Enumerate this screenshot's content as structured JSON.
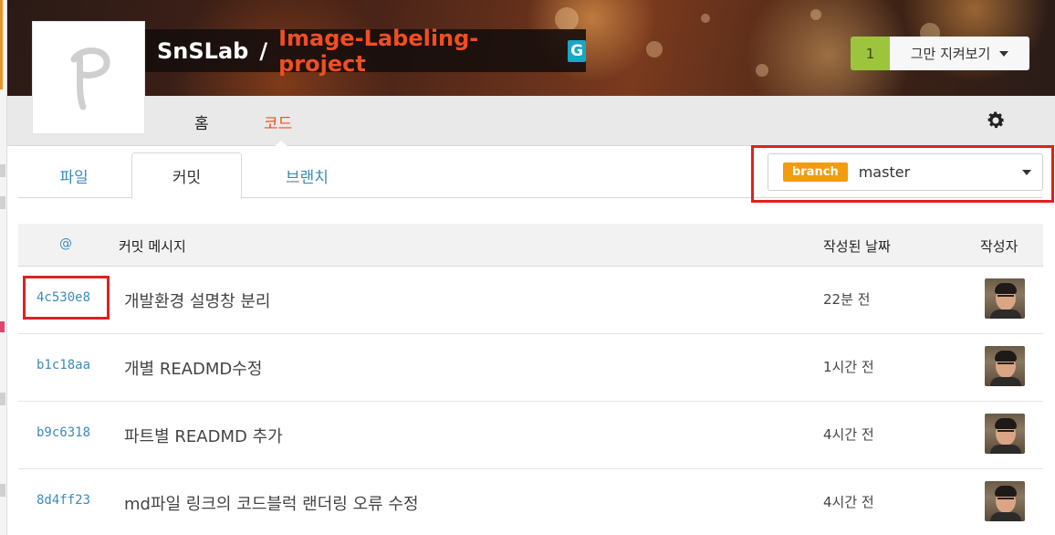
{
  "header": {
    "owner": "SnSLab",
    "separator": "/",
    "repo": "Image-Labeling-project",
    "repo_badge": "G",
    "watch_count": "1",
    "watch_label": "그만 지켜보기"
  },
  "nav": {
    "home": "홈",
    "code": "코드"
  },
  "tabs": {
    "files": "파일",
    "commits": "커밋",
    "branches": "브랜치"
  },
  "branch": {
    "label": "branch",
    "name": "master"
  },
  "table": {
    "columns": {
      "sha": "@",
      "message": "커밋 메시지",
      "date": "작성된 날짜",
      "author": "작성자"
    },
    "rows": [
      {
        "sha": "4c530e8",
        "message": "개발환경 설명창 분리",
        "date": "22분 전"
      },
      {
        "sha": "b1c18aa",
        "message": "개별 READMD수정",
        "date": "1시간 전"
      },
      {
        "sha": "b9c6318",
        "message": "파트별 READMD 추가",
        "date": "4시간 전"
      },
      {
        "sha": "8d4ff23",
        "message": "md파일 링크의 코드블럭 랜더링 오류 수정",
        "date": "4시간 전"
      }
    ]
  },
  "colors": {
    "accent": "#f04e23",
    "link": "#3b8bbb",
    "branch_badge": "#f39c12",
    "watch_count_bg": "#9dc43d",
    "highlight": "#e02020"
  },
  "icons": [
    "settings-gear-icon",
    "caret-down-icon",
    "project-logo-icon",
    "author-avatar"
  ]
}
